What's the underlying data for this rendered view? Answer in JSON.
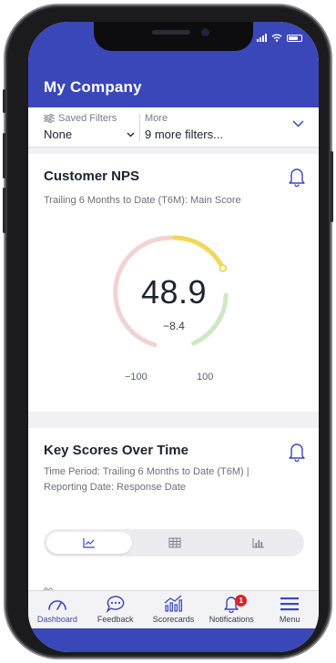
{
  "header": {
    "title": "My Company"
  },
  "filters": {
    "saved": {
      "label": "Saved Filters",
      "value": "None"
    },
    "more": {
      "label": "More",
      "value": "9 more filters..."
    }
  },
  "nps_card": {
    "title": "Customer NPS",
    "subtitle": "Trailing 6 Months to Date (T6M): Main Score",
    "score": "48.9",
    "delta": "−8.4",
    "min_label": "−100",
    "max_label": "100",
    "score_value": 48.9,
    "min_value": -100,
    "max_value": 100
  },
  "key_scores_card": {
    "title": "Key Scores Over Time",
    "subtitle_line1": "Time Period: Trailing 6 Months to Date (T6M) |",
    "subtitle_line2": "Reporting Date: Response Date",
    "view_toggle": [
      "line-chart-icon",
      "table-icon",
      "bar-chart-icon"
    ],
    "selected_view": "line-chart-icon",
    "y_tick_top": "80"
  },
  "tabbar": {
    "items": [
      {
        "label": "Dashboard",
        "icon": "gauge-icon",
        "active": true
      },
      {
        "label": "Feedback",
        "icon": "chat-bubble-icon",
        "active": false
      },
      {
        "label": "Scorecards",
        "icon": "trend-chart-icon",
        "active": false
      },
      {
        "label": "Notifications",
        "icon": "bell-icon",
        "active": false,
        "badge": "1"
      },
      {
        "label": "Menu",
        "icon": "hamburger-icon",
        "active": false
      }
    ]
  },
  "colors": {
    "brand": "#3a47b9",
    "gauge_yellow": "#f2d75a",
    "gauge_green": "#cfe8c8",
    "gauge_red": "#f2d3d3",
    "badge_red": "#d9252b"
  }
}
